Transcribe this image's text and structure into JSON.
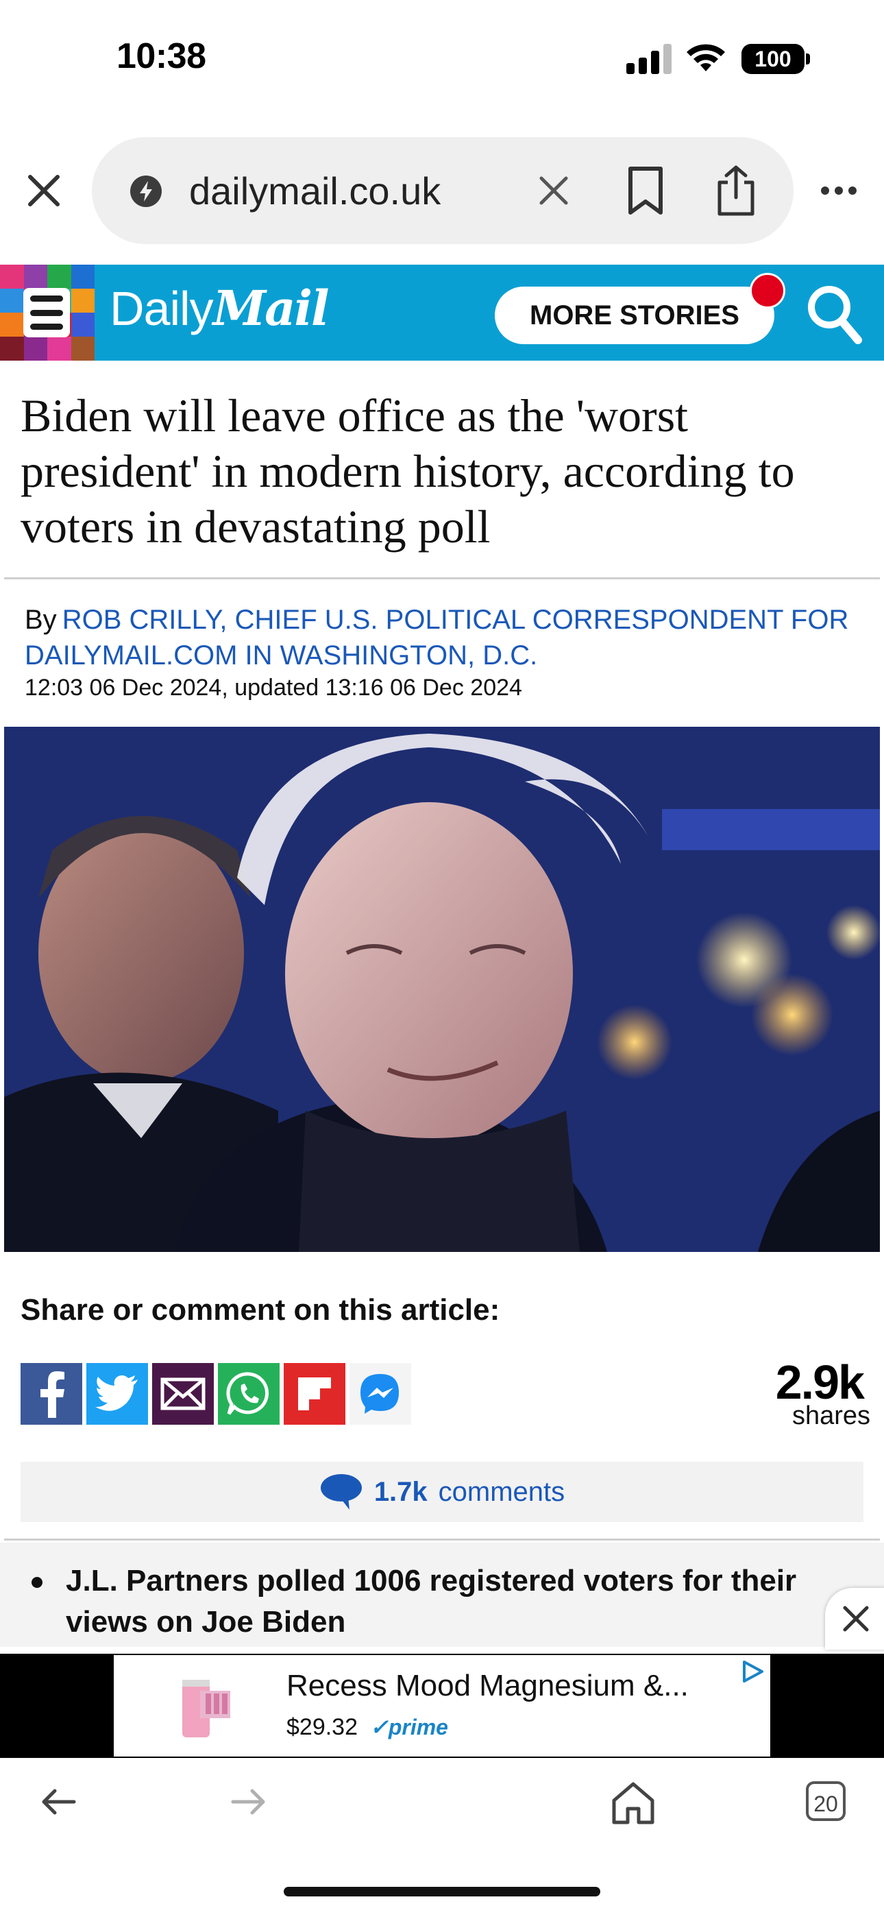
{
  "status_bar": {
    "time": "10:38",
    "battery": "100"
  },
  "browser": {
    "url": "dailymail.co.uk",
    "icons": {
      "close": "close-icon",
      "site": "site-info-icon",
      "clear": "clear-icon",
      "bookmark": "bookmark-icon",
      "share": "share-icon",
      "more": "more-dots-icon"
    }
  },
  "header": {
    "brand_daily": "Daily",
    "brand_mail": "Mail",
    "more_stories": "MORE STORIES",
    "brand_color": "#0a9fd3",
    "icons": {
      "menu": "hamburger-menu-icon",
      "search": "search-icon",
      "notification": "notification-dot"
    }
  },
  "article": {
    "headline": "Biden will leave office as the 'worst president' in modern history, according to voters in devastating poll",
    "byline_prefix": "By",
    "author": "ROB CRILLY, CHIEF U.S. POLITICAL CORRESPONDENT FOR DAILYMAIL.COM IN WASHINGTON, D.C.",
    "dateline": "12:03 06 Dec 2024, updated 13:16 06 Dec 2024",
    "share_title": "Share or comment on this article:",
    "share_count": "2.9k",
    "share_unit": "shares",
    "share_buttons": [
      "facebook-icon",
      "twitter-icon",
      "email-icon",
      "whatsapp-icon",
      "flipboard-icon",
      "messenger-icon"
    ],
    "comments_count": "1.7k",
    "comments_label": "comments",
    "bullets": [
      "J.L. Partners polled 1006 registered voters for their views on Joe Biden"
    ]
  },
  "ad": {
    "title": "Recess Mood Magnesium &...",
    "price": "$29.32",
    "prime": "prime"
  },
  "bottom_nav": {
    "tabs_count": "20"
  }
}
